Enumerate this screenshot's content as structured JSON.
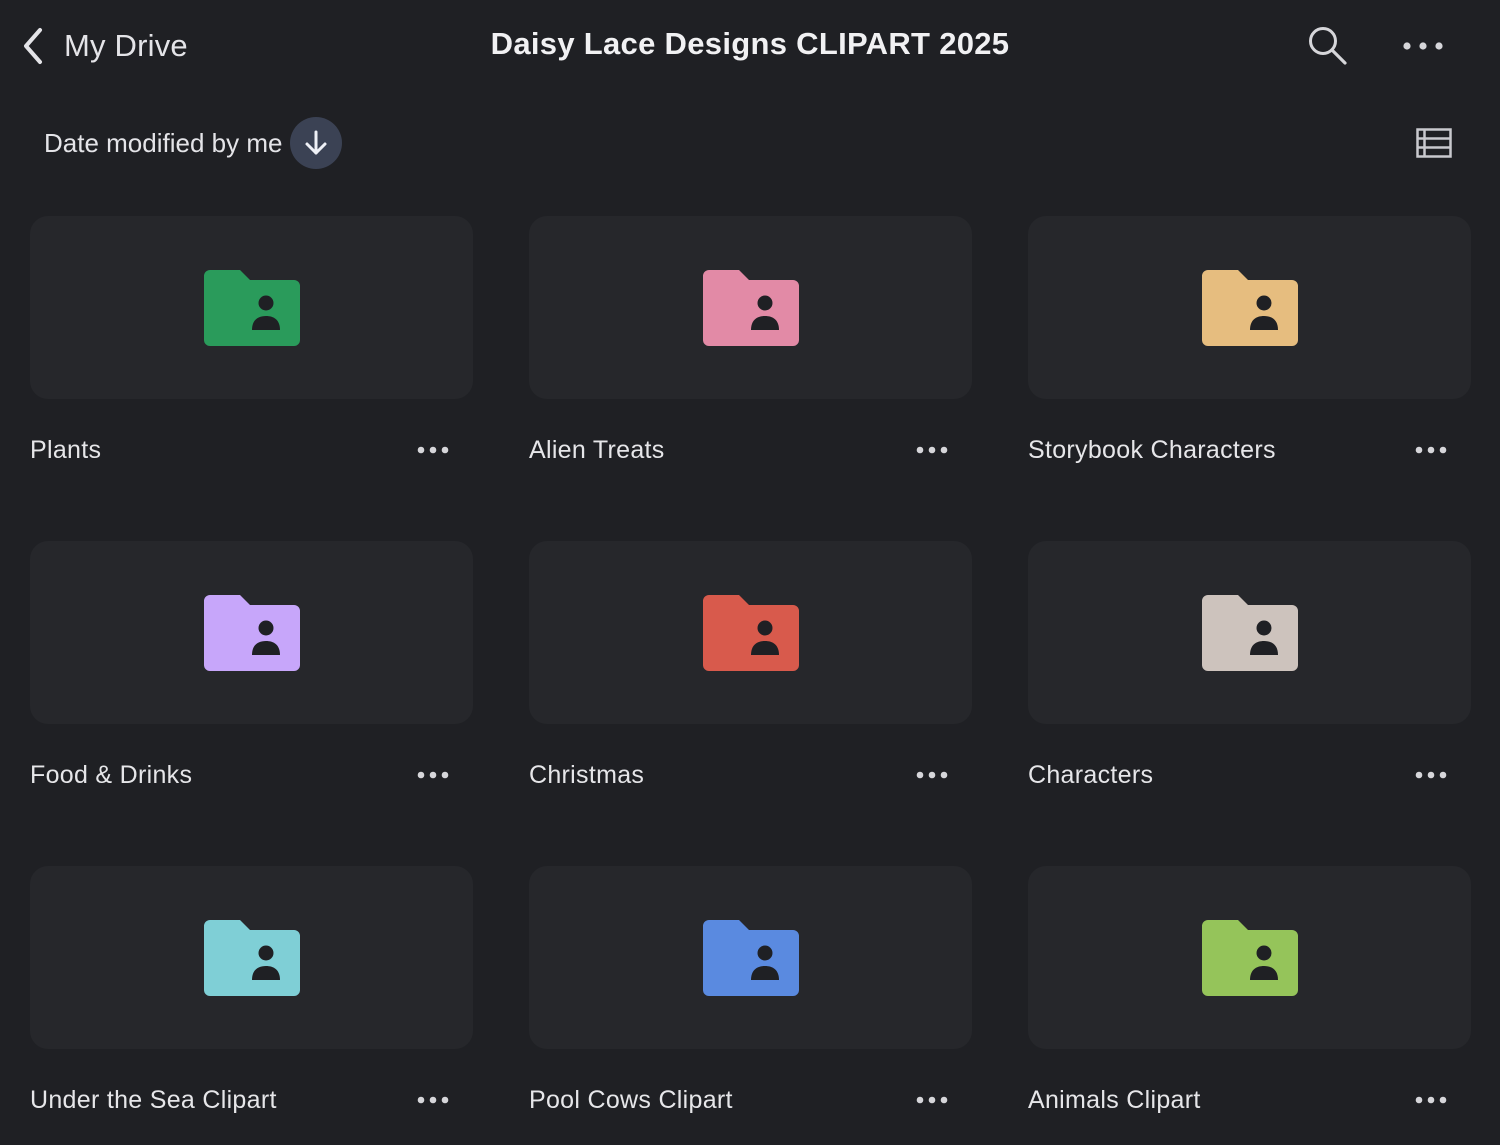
{
  "header": {
    "back_label": "My Drive",
    "title": "Daisy Lace Designs CLIPART 2025"
  },
  "sort": {
    "label": "Date modified by me",
    "direction": "descending"
  },
  "folders": [
    {
      "name": "Plants",
      "color": "#2a9b5b"
    },
    {
      "name": "Alien Treats",
      "color": "#e28aa6"
    },
    {
      "name": "Storybook Characters",
      "color": "#e6bd7f"
    },
    {
      "name": "Food & Drinks",
      "color": "#c7a6fa"
    },
    {
      "name": "Christmas",
      "color": "#d85a4c"
    },
    {
      "name": "Characters",
      "color": "#cdc3bd"
    },
    {
      "name": "Under the Sea Clipart",
      "color": "#7fcfd6"
    },
    {
      "name": "Pool Cows Clipart",
      "color": "#5a8ae0"
    },
    {
      "name": "Animals Clipart",
      "color": "#95c45a"
    }
  ],
  "colors": {
    "background": "#1f2024",
    "card": "#26272b",
    "text": "#e6e6e9",
    "sort_button": "#3b4254"
  }
}
